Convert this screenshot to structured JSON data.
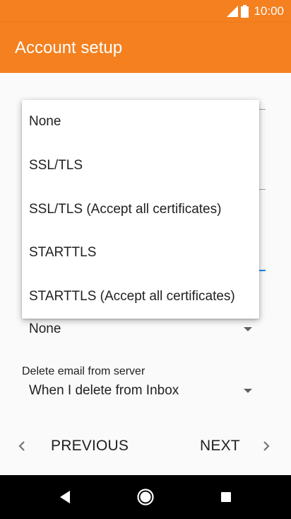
{
  "status_bar": {
    "time": "10:00",
    "signal_icon": "signal-icon",
    "battery_icon": "battery-icon"
  },
  "app_bar": {
    "title": "Account setup"
  },
  "security_field": {
    "value": "None"
  },
  "delete_field": {
    "label": "Delete email from server",
    "value": "When I delete from Inbox"
  },
  "footer": {
    "previous_label": "PREVIOUS",
    "next_label": "NEXT"
  },
  "dropdown": {
    "items": [
      {
        "label": "None"
      },
      {
        "label": "SSL/TLS"
      },
      {
        "label": "SSL/TLS (Accept all certificates)"
      },
      {
        "label": "STARTTLS"
      },
      {
        "label": "STARTTLS (Accept all certificates)"
      }
    ]
  },
  "colors": {
    "accent": "#f4801f",
    "focus": "#1e88e5"
  },
  "nav_bar": {
    "back_icon": "back-icon",
    "home_icon": "home-icon",
    "recents_icon": "recents-icon"
  }
}
